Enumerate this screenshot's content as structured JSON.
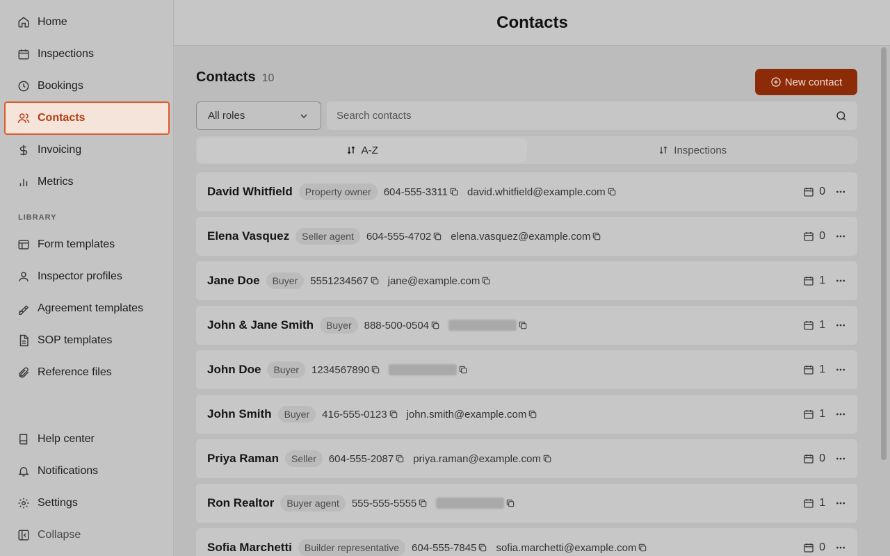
{
  "sidebar": {
    "items": [
      {
        "label": "Home",
        "icon": "home-icon"
      },
      {
        "label": "Inspections",
        "icon": "calendar-icon"
      },
      {
        "label": "Bookings",
        "icon": "clock-icon"
      },
      {
        "label": "Contacts",
        "icon": "users-icon"
      },
      {
        "label": "Invoicing",
        "icon": "dollar-icon"
      },
      {
        "label": "Metrics",
        "icon": "bar-chart-icon"
      }
    ],
    "library_label": "LIBRARY",
    "library_items": [
      {
        "label": "Form templates",
        "icon": "layout-icon"
      },
      {
        "label": "Inspector profiles",
        "icon": "user-icon"
      },
      {
        "label": "Agreement templates",
        "icon": "signature-icon"
      },
      {
        "label": "SOP templates",
        "icon": "document-icon"
      },
      {
        "label": "Reference files",
        "icon": "paperclip-icon"
      }
    ],
    "bottom_items": [
      {
        "label": "Help center",
        "icon": "book-icon"
      },
      {
        "label": "Notifications",
        "icon": "bell-icon"
      },
      {
        "label": "Settings",
        "icon": "gear-icon"
      },
      {
        "label": "Collapse",
        "icon": "collapse-icon"
      }
    ]
  },
  "header": {
    "title": "Contacts"
  },
  "content": {
    "title": "Contacts",
    "count": "10",
    "new_button": "New contact",
    "role_filter": "All roles",
    "search_placeholder": "Search contacts",
    "sort_tabs": [
      "A-Z",
      "Inspections"
    ]
  },
  "contacts": [
    {
      "name": "David Whitfield",
      "role": "Property owner",
      "phone": "604-555-3311",
      "email": "david.whitfield@example.com",
      "inspections": "0"
    },
    {
      "name": "Elena Vasquez",
      "role": "Seller agent",
      "phone": "604-555-4702",
      "email": "elena.vasquez@example.com",
      "inspections": "0"
    },
    {
      "name": "Jane Doe",
      "role": "Buyer",
      "phone": "5551234567",
      "email": "jane@example.com",
      "inspections": "1"
    },
    {
      "name": "John & Jane Smith",
      "role": "Buyer",
      "phone": "888-500-0504",
      "email": "",
      "inspections": "1"
    },
    {
      "name": "John Doe",
      "role": "Buyer",
      "phone": "1234567890",
      "email": "",
      "inspections": "1"
    },
    {
      "name": "John Smith",
      "role": "Buyer",
      "phone": "416-555-0123",
      "email": "john.smith@example.com",
      "inspections": "1"
    },
    {
      "name": "Priya Raman",
      "role": "Seller",
      "phone": "604-555-2087",
      "email": "priya.raman@example.com",
      "inspections": "0"
    },
    {
      "name": "Ron Realtor",
      "role": "Buyer agent",
      "phone": "555-555-5555",
      "email": "",
      "inspections": "1"
    },
    {
      "name": "Sofia Marchetti",
      "role": "Builder representative",
      "phone": "604-555-7845",
      "email": "sofia.marchetti@example.com",
      "inspections": "0"
    }
  ],
  "colors": {
    "accent": "#8c2b08",
    "active_border": "#e05a2e",
    "active_bg": "#f5e4da"
  }
}
